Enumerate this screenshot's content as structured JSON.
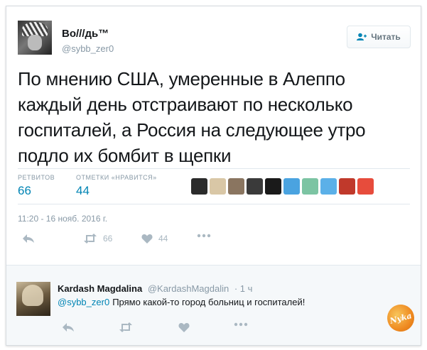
{
  "tweet": {
    "author": {
      "name": "Во///дь™",
      "handle": "@sybb_zer0"
    },
    "follow_label": "Читать",
    "text": "По мнению США, умеренные в Алеппо каждый день отстраивают по несколько госпиталей, а Россия на следующее утро подло их бомбит в щепки",
    "stats": {
      "retweets_label": "РЕТВИТОВ",
      "retweets_value": "66",
      "likes_label": "ОТМЕТКИ «НРАВИТСЯ»",
      "likes_value": "44"
    },
    "likers_colors": [
      "#2b2b2b",
      "#d9c7a6",
      "#8a7560",
      "#3a3a3a",
      "#1a1a1a",
      "#4aa3e0",
      "#7cc4a3",
      "#5bb0e8",
      "#c0392b",
      "#e74c3c"
    ],
    "timestamp": "11:20 - 16 нояб. 2016 г.",
    "actions": {
      "retweet_count": "66",
      "like_count": "44"
    }
  },
  "reply": {
    "name": "Kardash Magdalina",
    "handle": "@KardashMagdalin",
    "time": "· 1 ч",
    "mention": "@sybb_zer0",
    "text": "Прямо какой-то город больниц и госпиталей!"
  },
  "watermark": {
    "text": "Nyka"
  },
  "colors": {
    "link": "#0084b4",
    "muted": "#8899a6",
    "icon": "#aab8c2",
    "watermark": "#ef8b22"
  }
}
